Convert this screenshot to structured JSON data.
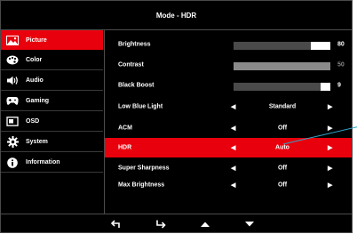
{
  "title": "Mode - HDR",
  "sidebar": {
    "items": [
      {
        "label": "Picture",
        "icon": "picture-icon",
        "active": true
      },
      {
        "label": "Color",
        "icon": "palette-icon",
        "active": false
      },
      {
        "label": "Audio",
        "icon": "speaker-icon",
        "active": false
      },
      {
        "label": "Gaming",
        "icon": "gamepad-icon",
        "active": false
      },
      {
        "label": "OSD",
        "icon": "osd-icon",
        "active": false
      },
      {
        "label": "System",
        "icon": "gear-icon",
        "active": false
      },
      {
        "label": "Information",
        "icon": "info-icon",
        "active": false
      }
    ]
  },
  "settings": [
    {
      "label": "Brightness",
      "type": "slider",
      "value": "80",
      "level": 80
    },
    {
      "label": "Contrast",
      "type": "slider",
      "value": "50",
      "level": 50,
      "disabled": true
    },
    {
      "label": "Black Boost",
      "type": "slider",
      "value": "9",
      "level": 90
    },
    {
      "label": "Low Blue Light",
      "type": "option",
      "value": "Standard"
    },
    {
      "label": "ACM",
      "type": "option",
      "value": "Off"
    },
    {
      "label": "HDR",
      "type": "option",
      "value": "Auto",
      "active": true
    },
    {
      "label": "Super Sharpness",
      "type": "option",
      "value": "Off"
    },
    {
      "label": "Max Brightness",
      "type": "option",
      "value": "Off"
    }
  ],
  "footer": {
    "buttons": [
      "back-icon",
      "enter-icon",
      "up-icon",
      "down-icon"
    ]
  },
  "colors": {
    "accent": "#e8000c",
    "background": "#000000",
    "pointer": "#2fa3c8"
  }
}
